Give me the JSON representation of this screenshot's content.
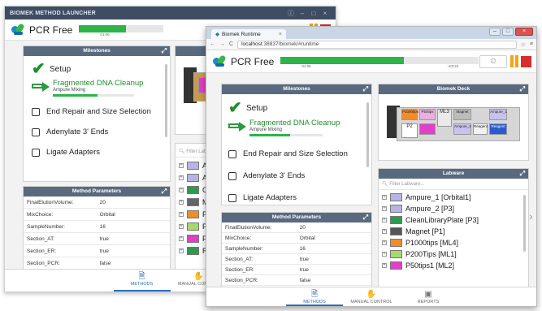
{
  "back_window": {
    "title": "BIOMEK METHOD LAUNCHER",
    "method_name": "PCR Free",
    "progress_fill": 0.55,
    "progress_label": "01:06",
    "milestones_title": "Milestones",
    "milestones": [
      {
        "label": "Setup",
        "state": "done"
      },
      {
        "label": "Fragmented DNA Cleanup",
        "state": "active",
        "sub": "Ampure Mixing",
        "sub_progress": 0.55
      },
      {
        "label": "End Repair and Size Selection",
        "state": "pending"
      },
      {
        "label": "Adenylate 3' Ends",
        "state": "pending"
      },
      {
        "label": "Ligate Adapters",
        "state": "pending"
      }
    ],
    "params_title": "Method Parameters",
    "params": [
      {
        "k": "FinalElutionVolume:",
        "v": "20"
      },
      {
        "k": "MixChoice:",
        "v": "Orbital"
      },
      {
        "k": "SampleNumber:",
        "v": "16"
      },
      {
        "k": "Section_AT:",
        "v": "true"
      },
      {
        "k": "Section_ER:",
        "v": "true"
      },
      {
        "k": "Section_PCR:",
        "v": "false"
      }
    ],
    "filter_placeholder": "Filter Labware",
    "labware": [
      {
        "label": "Am",
        "color": "#b8b3e6"
      },
      {
        "label": "Am",
        "color": "#b8b3e6"
      },
      {
        "label": "Cle",
        "color": "#2e9a4e"
      },
      {
        "label": "Ma",
        "color": "#666666"
      },
      {
        "label": "P1",
        "color": "#f28c28"
      },
      {
        "label": "P2",
        "color": "#a6d86e"
      },
      {
        "label": "P5",
        "color": "#e040c8"
      },
      {
        "label": "Re",
        "color": "#2e9a4e"
      }
    ],
    "nav": [
      {
        "label": "METHODS",
        "icon": "🗎",
        "active": true
      },
      {
        "label": "MANUAL CONTROL",
        "icon": "✋",
        "active": false
      }
    ]
  },
  "front_window": {
    "tab_title": "Biomek Runtime",
    "url_host": "localhost",
    "url_rest": ":38837/biomek/#runtime",
    "method_name": "PCR Free",
    "progress_fill": 0.62,
    "progress_label_start": "01:06",
    "progress_label_end": "~03:22",
    "milestones_title": "Milestones",
    "milestones": [
      {
        "label": "Setup",
        "state": "done"
      },
      {
        "label": "Fragmented DNA Cleanup",
        "state": "active",
        "sub": "Ampure Mixing",
        "sub_progress": 0.55
      },
      {
        "label": "End Repair and Size Selection",
        "state": "pending"
      },
      {
        "label": "Adenylate 3' Ends",
        "state": "pending"
      },
      {
        "label": "Ligate Adapters",
        "state": "pending"
      }
    ],
    "deck_title": "Biomek Deck",
    "deck_labels": [
      "P1000tips",
      "P50tips",
      "ML3",
      "Magnet",
      "Ampure_1",
      "P2",
      "Ampure_2",
      "Reagent",
      "Reagent"
    ],
    "params_title": "Method Parameters",
    "params": [
      {
        "k": "FinalElutionVolume:",
        "v": "20"
      },
      {
        "k": "MixChoice:",
        "v": "Orbital"
      },
      {
        "k": "SampleNumber:",
        "v": "16"
      },
      {
        "k": "Section_AT:",
        "v": "true"
      },
      {
        "k": "Section_ER:",
        "v": "true"
      },
      {
        "k": "Section_PCR:",
        "v": "false"
      }
    ],
    "labware_title": "Labware",
    "filter_placeholder": "Filter Labware...",
    "labware": [
      {
        "label": "Ampure_1 [Orbital1]",
        "color": "#b8b3e6"
      },
      {
        "label": "Ampure_2 [P3]",
        "color": "#b8b3e6"
      },
      {
        "label": "CleanLibraryPlate [P3]",
        "color": "#2e9a4e"
      },
      {
        "label": "Magnet [P1]",
        "color": "#555555"
      },
      {
        "label": "P1000tips [ML4]",
        "color": "#f28c28"
      },
      {
        "label": "P200Tips [ML1]",
        "color": "#a6d86e"
      },
      {
        "label": "P50tips1 [ML2]",
        "color": "#e040c8"
      }
    ],
    "nav": [
      {
        "label": "METHODS",
        "icon": "🗎",
        "active": true
      },
      {
        "label": "MANUAL CONTROL",
        "icon": "✋",
        "active": false
      },
      {
        "label": "REPORTS",
        "icon": "▣",
        "active": false
      }
    ]
  }
}
